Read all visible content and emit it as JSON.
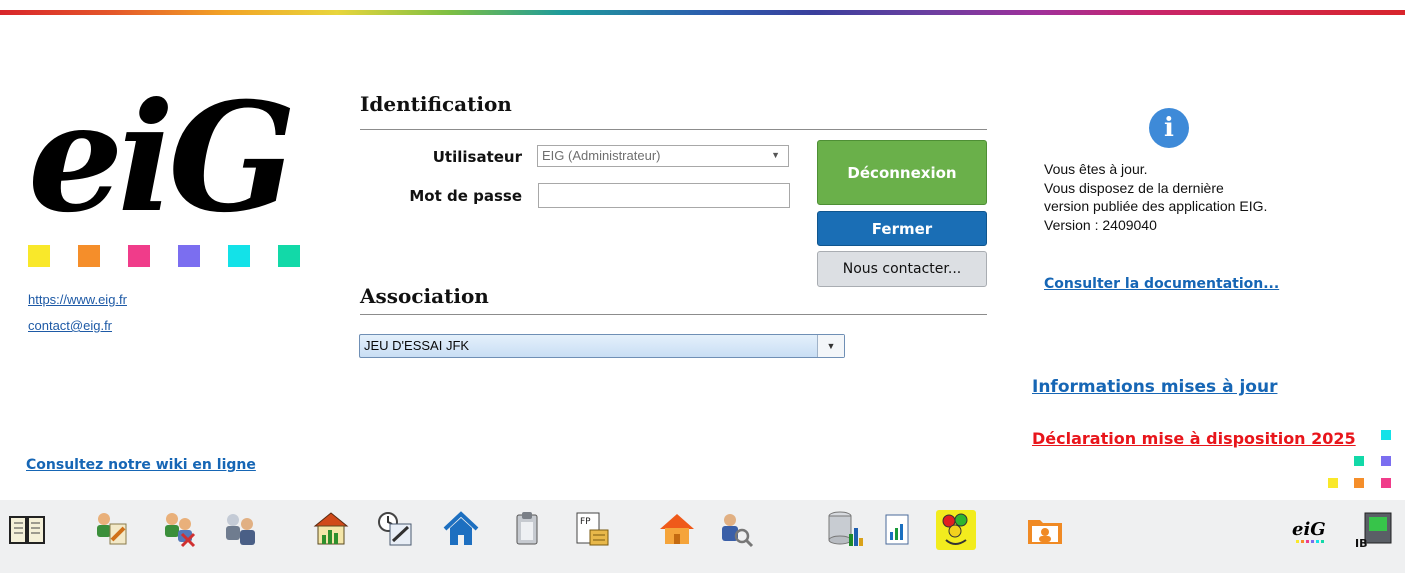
{
  "brand": {
    "logo_text": "eiG",
    "website": "https://www.eig.fr",
    "email": "contact@eig.fr",
    "colors": {
      "yellow": "#f9e82a",
      "orange": "#f58e2a",
      "magenta": "#f03c8a",
      "purple": "#7b6ef0",
      "cyan": "#13e2e8",
      "teal": "#12d9a8"
    }
  },
  "identification": {
    "title": "Identification",
    "user_label": "Utilisateur",
    "user_value": "EIG (Administrateur)",
    "password_label": "Mot de passe",
    "password_value": ""
  },
  "buttons": {
    "disconnect": "Déconnexion",
    "close": "Fermer",
    "contact": "Nous contacter..."
  },
  "association": {
    "title": "Association",
    "selected": "JEU D'ESSAI JFK"
  },
  "info_panel": {
    "icon": "info-icon",
    "line1": "Vous êtes à jour.",
    "line2": "Vous disposez de la dernière",
    "line3": "version publiée des application EIG.",
    "line4": "Version : 2409040",
    "doc_link": "Consulter la documentation..."
  },
  "updates_link": "Informations mises à jour",
  "declaration_link": "Déclaration mise à disposition 2025",
  "wiki_link": "Consultez notre wiki en ligne",
  "toolbar": {
    "icons": [
      "book-icon",
      "users-edit-icon",
      "users-remove-icon",
      "users-group-icon",
      "building-chart-icon",
      "calendar-edit-icon",
      "home-icon",
      "document-clip-icon",
      "fp-document-icon",
      "house-orange-icon",
      "user-search-icon",
      "database-chart-icon",
      "report-icon",
      "traffic-lights-highlighted-icon",
      "folder-person-icon",
      "eig-logo-icon",
      "ib-device-icon"
    ]
  }
}
